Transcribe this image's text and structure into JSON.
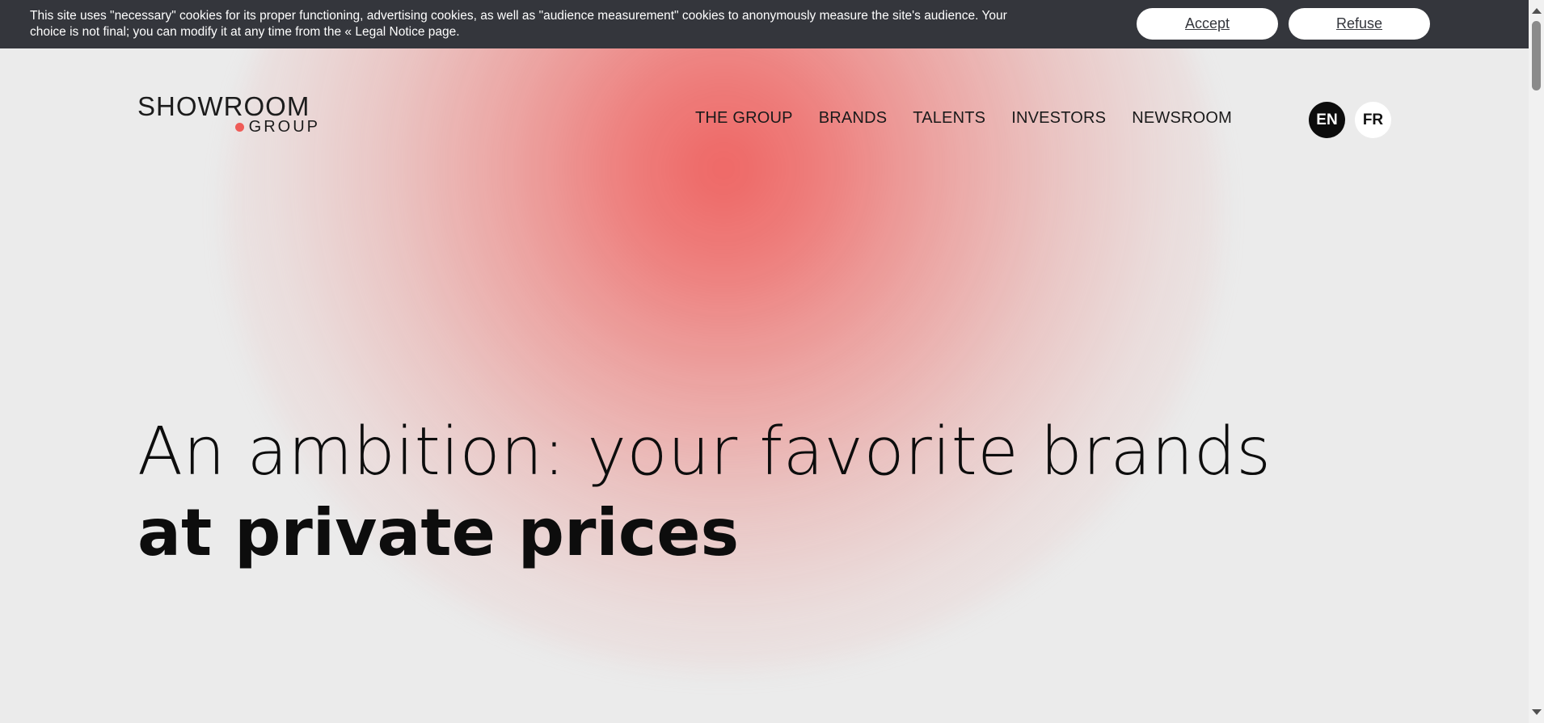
{
  "cookie_banner": {
    "message": "This site uses \"necessary\" cookies for its proper functioning, advertising cookies, as well as \"audience measurement\" cookies to anonymously measure the site's audience. Your choice is not final; you can modify it at any time from the « Legal Notice page.",
    "accept_label": "Accept",
    "refuse_label": "Refuse"
  },
  "header": {
    "logo": {
      "top": "SHOWROOM",
      "bottom": "GROUP"
    },
    "nav": [
      {
        "label": "THE GROUP"
      },
      {
        "label": "BRANDS"
      },
      {
        "label": "TALENTS"
      },
      {
        "label": "INVESTORS"
      },
      {
        "label": "NEWSROOM"
      }
    ],
    "languages": {
      "active": "EN",
      "other": "FR"
    }
  },
  "hero": {
    "line1": "An ambition: your favorite brands",
    "line2": "at private prices"
  },
  "colors": {
    "accent": "#ef5b57",
    "cookie_bar": "#34363c",
    "background": "#ebebeb"
  }
}
